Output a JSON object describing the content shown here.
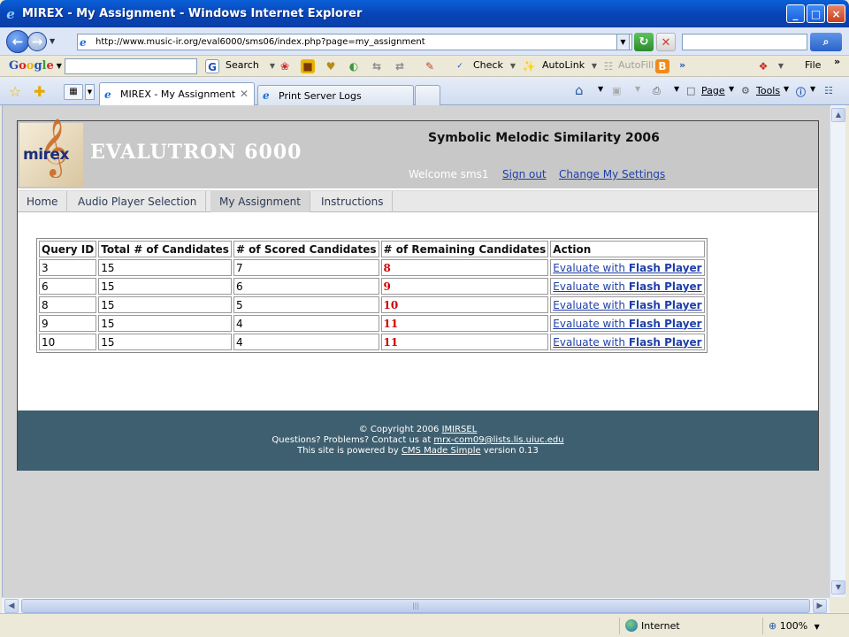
{
  "window": {
    "title": "MIREX - My Assignment - Windows Internet Explorer",
    "min": "_",
    "max": "□",
    "close": "×"
  },
  "address": {
    "url": "http://www.music-ir.org/eval6000/sms06/index.php?page=my_assignment"
  },
  "google_toolbar": {
    "search_label": "Search",
    "check_label": "Check",
    "autolink_label": "AutoLink",
    "autofill_label": "AutoFill",
    "more": "»",
    "file_label": "File",
    "overflow": "»"
  },
  "tabs": [
    {
      "label": "MIREX - My Assignment",
      "active": true
    },
    {
      "label": "Print Server Logs",
      "active": false
    }
  ],
  "tab_tools": {
    "page_label": "Page",
    "tools_label": "Tools"
  },
  "site": {
    "logo_text": "mirex",
    "brand": "EVALUTRON 6000",
    "title": "Symbolic Melodic Similarity 2006",
    "welcome": "Welcome sms1",
    "sign_out": "Sign out",
    "settings": "Change My Settings"
  },
  "nav": [
    "Home",
    "Audio Player Selection",
    "My Assignment",
    "Instructions"
  ],
  "table": {
    "headers": [
      "Query ID",
      "Total # of Candidates",
      "# of Scored Candidates",
      "# of Remaining Candidates",
      "Action"
    ],
    "action_prefix": "Evaluate with ",
    "action_bold": "Flash Player",
    "rows": [
      {
        "query": "3",
        "total": "15",
        "scored": "7",
        "remaining": "8"
      },
      {
        "query": "6",
        "total": "15",
        "scored": "6",
        "remaining": "9"
      },
      {
        "query": "8",
        "total": "15",
        "scored": "5",
        "remaining": "10"
      },
      {
        "query": "9",
        "total": "15",
        "scored": "4",
        "remaining": "11"
      },
      {
        "query": "10",
        "total": "15",
        "scored": "4",
        "remaining": "11"
      }
    ]
  },
  "footer": {
    "copyright_prefix": "© Copyright 2006 ",
    "copyright_link": "IMIRSEL",
    "contact_prefix": "Questions? Problems? Contact us at ",
    "contact_link": "mrx-com09@lists.lis.uiuc.edu",
    "powered_prefix": "This site is powered by ",
    "powered_link": "CMS Made Simple",
    "powered_suffix": " version 0.13"
  },
  "status": {
    "zone": "Internet",
    "zoom": "100%"
  }
}
